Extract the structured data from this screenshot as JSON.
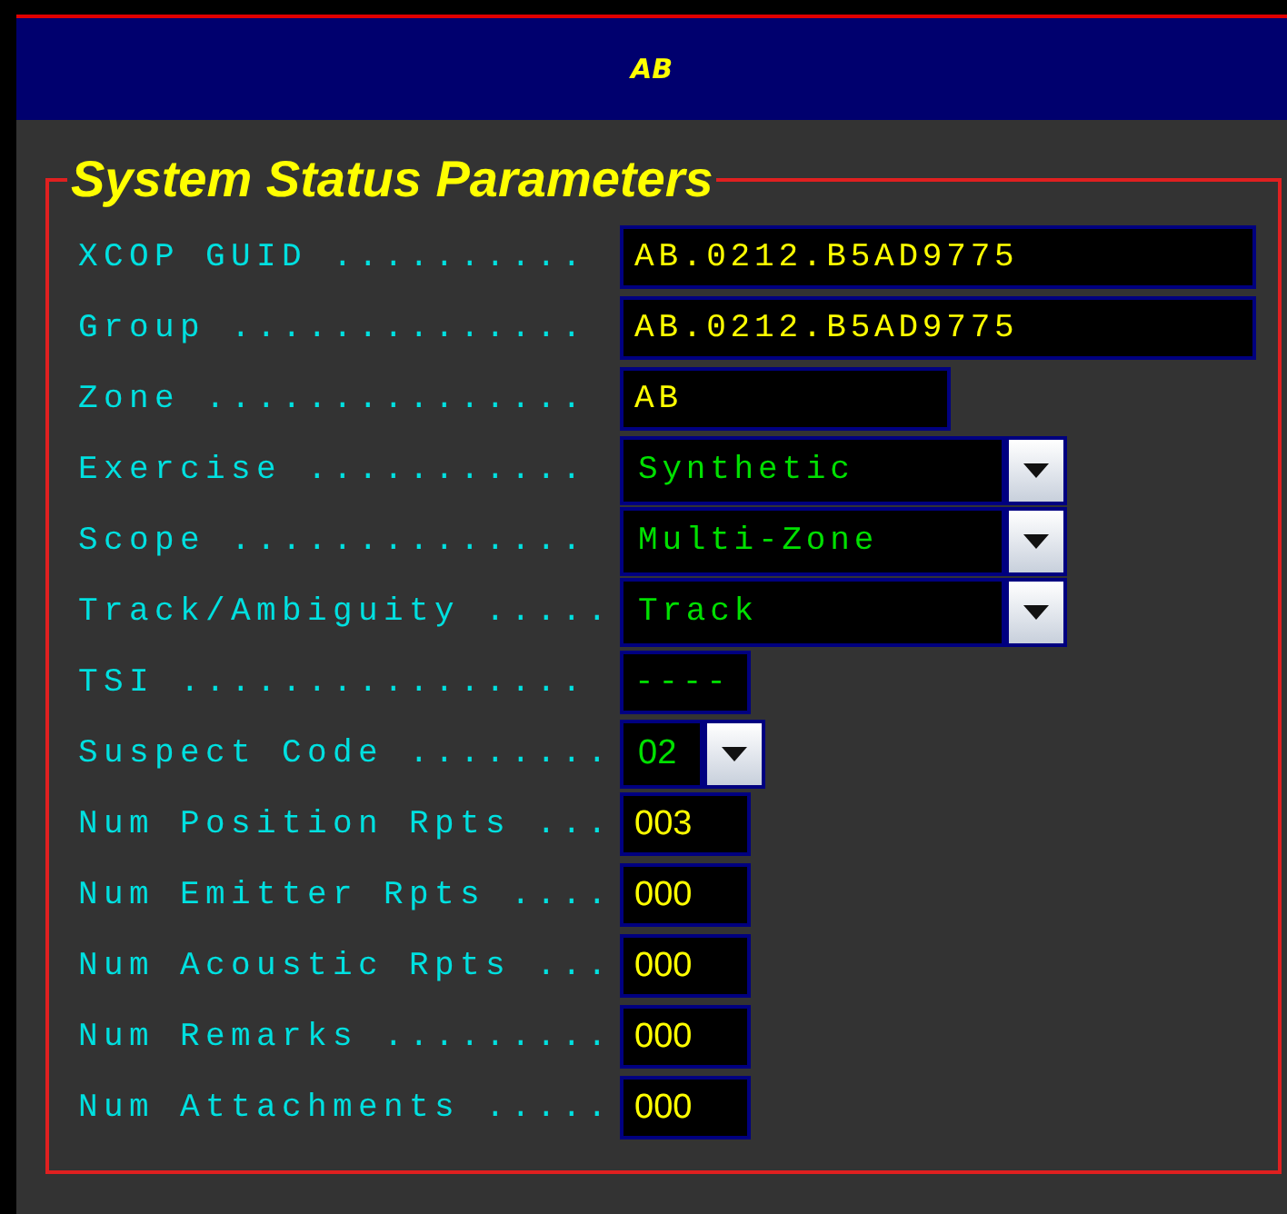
{
  "header": {
    "title": "AB"
  },
  "panel": {
    "title": "System Status Parameters",
    "fields": [
      {
        "label": "XCOP GUID ..........",
        "value": "AB.0212.B5AD9775",
        "kind": "wide"
      },
      {
        "label": "Group ..............",
        "value": "AB.0212.B5AD9775",
        "kind": "wide"
      },
      {
        "label": "Zone ...............",
        "value": "AB",
        "kind": "text"
      },
      {
        "label": "Exercise ...........",
        "value": "Synthetic",
        "kind": "combo"
      },
      {
        "label": "Scope ..............",
        "value": "Multi-Zone",
        "kind": "combo"
      },
      {
        "label": "Track/Ambiguity .....",
        "value": "Track",
        "kind": "combo"
      },
      {
        "label": "TSI ................",
        "value": "----",
        "kind": "readonly"
      },
      {
        "label": "Suspect Code ........",
        "value": "02",
        "kind": "shortcombo"
      },
      {
        "label": "Num Position Rpts ...",
        "value": "003",
        "kind": "count"
      },
      {
        "label": "Num Emitter Rpts ....",
        "value": "000",
        "kind": "count"
      },
      {
        "label": "Num Acoustic Rpts ...",
        "value": "000",
        "kind": "count"
      },
      {
        "label": "Num Remarks .........",
        "value": "000",
        "kind": "count"
      },
      {
        "label": "Num Attachments .....",
        "value": "000",
        "kind": "count"
      }
    ]
  }
}
